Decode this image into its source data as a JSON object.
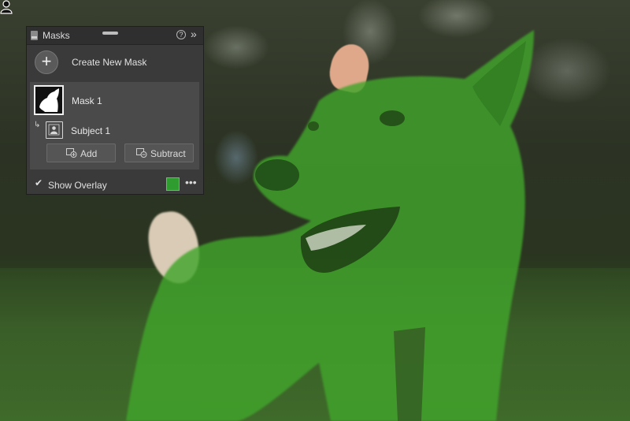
{
  "panel": {
    "title": "Masks",
    "help_glyph": "?",
    "collapse_glyph": "»",
    "create_button_glyph": "+",
    "create_label": "Create New Mask",
    "mask": {
      "name": "Mask 1",
      "component_arrow": "↳",
      "component_label": "Subject 1",
      "add_label": "Add",
      "subtract_label": "Subtract"
    },
    "overlay": {
      "checkbox_glyph": "✔",
      "label": "Show Overlay",
      "checked": true,
      "color": "#2e9c2e",
      "more_glyph": "•••"
    }
  },
  "icons": [
    "panel-icon",
    "help-icon",
    "collapse-icon",
    "add-mask-icon",
    "subject-person-icon",
    "add-icon",
    "subtract-icon",
    "more-icon",
    "subject-cursor-icon"
  ],
  "photo": {
    "overlay_color": "#3fa22a",
    "overlay_opacity": 0.75
  }
}
